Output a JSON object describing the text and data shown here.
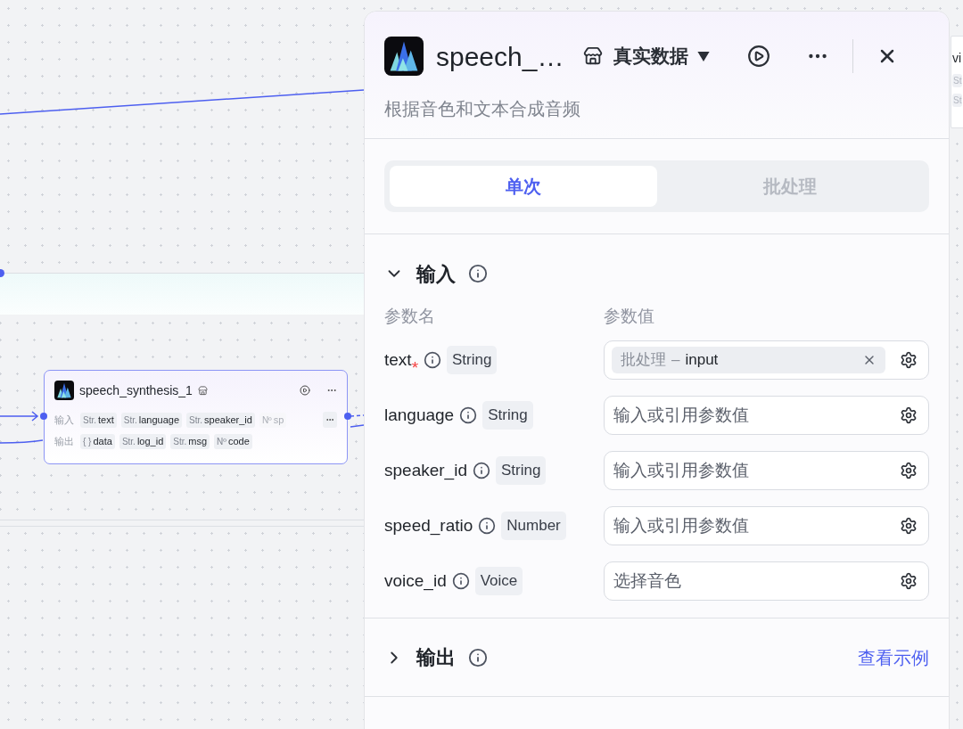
{
  "canvas": {
    "node": {
      "title": "speech_synthesis_1",
      "input_label": "输入",
      "inputs": [
        {
          "type": "Str.",
          "name": "text",
          "faded": false
        },
        {
          "type": "Str.",
          "name": "language",
          "faded": false
        },
        {
          "type": "Str.",
          "name": "speaker_id",
          "faded": false
        },
        {
          "type": "Nº",
          "name": "sp",
          "faded": true
        }
      ],
      "output_label": "输出",
      "outputs": [
        {
          "type": "{ }",
          "name": "data",
          "faded": false
        },
        {
          "type": "Str.",
          "name": "log_id",
          "faded": false
        },
        {
          "type": "Str.",
          "name": "msg",
          "faded": false
        },
        {
          "type": "Nº",
          "name": "code",
          "faded": false
        }
      ]
    },
    "partial_node": {
      "title": "vi",
      "tags": [
        "St",
        "St"
      ]
    }
  },
  "panel": {
    "title": "speech_…",
    "data_mode": "真实数据",
    "description": "根据音色和文本合成音频",
    "tabs": [
      {
        "label": "单次",
        "selected": true
      },
      {
        "label": "批处理",
        "selected": false
      }
    ],
    "input_section": {
      "title": "输入",
      "expanded": true,
      "columns": [
        "参数名",
        "参数值"
      ],
      "params": [
        {
          "name": "text",
          "required_mark": "*",
          "type": "String",
          "value": {
            "source": "批处理",
            "separator": "–",
            "variable": "input"
          }
        },
        {
          "name": "language",
          "type": "String",
          "placeholder": "输入或引用参数值"
        },
        {
          "name": "speaker_id",
          "type": "String",
          "placeholder": "输入或引用参数值"
        },
        {
          "name": "speed_ratio",
          "type": "Number",
          "placeholder": "输入或引用参数值"
        },
        {
          "name": "voice_id",
          "type": "Voice",
          "placeholder": "选择音色"
        }
      ]
    },
    "output_section": {
      "title": "输出",
      "expanded": false,
      "link": "查看示例"
    }
  }
}
